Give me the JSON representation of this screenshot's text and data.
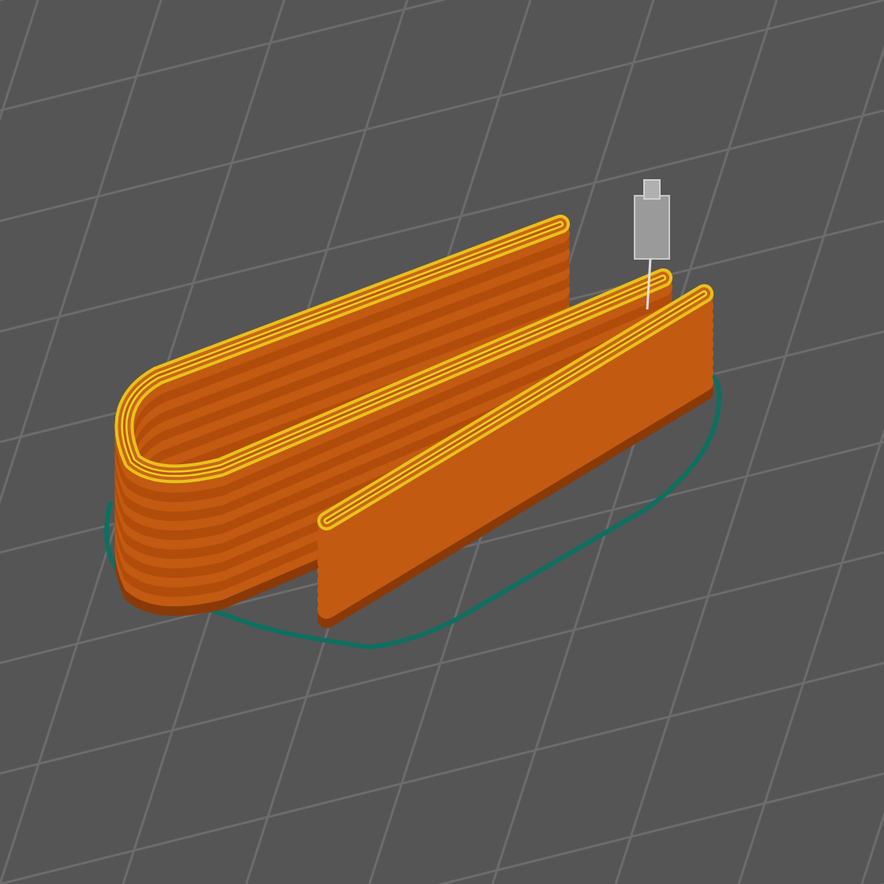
{
  "viewport": {
    "kind": "layer-preview"
  }
}
